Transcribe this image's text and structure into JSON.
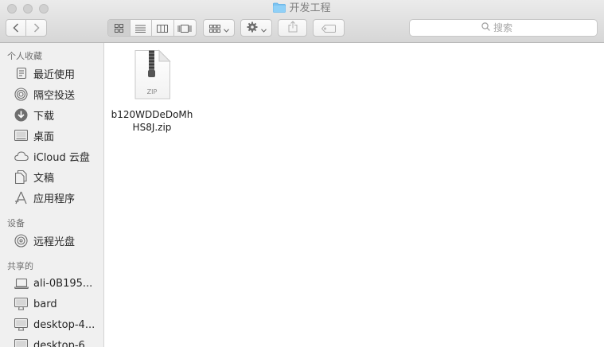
{
  "window": {
    "title": "开发工程"
  },
  "toolbar": {
    "back_icon": "chevron-left-icon",
    "forward_icon": "chevron-right-icon",
    "view_icons": [
      "icon-view-icon",
      "list-view-icon",
      "column-view-icon",
      "gallery-view-icon"
    ],
    "arrange_icon": "arrange-icon",
    "action_icon": "gear-icon",
    "share_icon": "share-icon",
    "tag_icon": "tag-icon",
    "search_placeholder": "搜索"
  },
  "sidebar": {
    "favorites_title": "个人收藏",
    "favorites": [
      {
        "label": "最近使用",
        "icon": "recents-icon"
      },
      {
        "label": "隔空投送",
        "icon": "airdrop-icon"
      },
      {
        "label": "下载",
        "icon": "downloads-icon"
      },
      {
        "label": "桌面",
        "icon": "desktop-icon"
      },
      {
        "label": "iCloud 云盘",
        "icon": "icloud-icon"
      },
      {
        "label": "文稿",
        "icon": "documents-icon"
      },
      {
        "label": "应用程序",
        "icon": "applications-icon"
      }
    ],
    "devices_title": "设备",
    "devices": [
      {
        "label": "远程光盘",
        "icon": "disc-icon"
      }
    ],
    "shared_title": "共享的",
    "shared": [
      {
        "label": "ali-0B195...",
        "icon": "laptop-icon"
      },
      {
        "label": "bard",
        "icon": "monitor-icon"
      },
      {
        "label": "desktop-4...",
        "icon": "monitor-icon"
      },
      {
        "label": "desktop-6...",
        "icon": "monitor-icon"
      }
    ]
  },
  "content": {
    "files": [
      {
        "name": "b120WDDeDoMhHS8J.zip",
        "badge": "ZIP",
        "icon": "zip-file-icon"
      }
    ]
  }
}
